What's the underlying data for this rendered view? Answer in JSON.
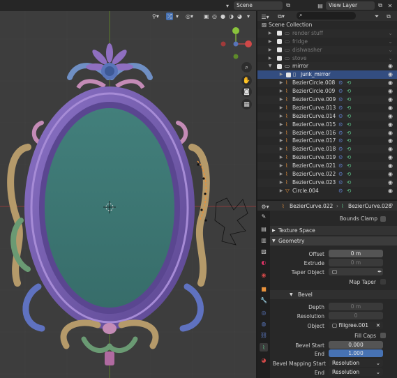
{
  "top_bar": {
    "scene_label": "Scene",
    "view_layer_label": "View Layer"
  },
  "outliner": {
    "search_placeholder": "",
    "rows": [
      {
        "name": "Scene Collection",
        "type": "scene",
        "dim": false
      },
      {
        "name": "render stuff",
        "type": "collection",
        "dim": true
      },
      {
        "name": "fridge",
        "type": "collection",
        "dim": true
      },
      {
        "name": "dishwasher",
        "type": "collection",
        "dim": true
      },
      {
        "name": "stove",
        "type": "collection",
        "dim": true
      },
      {
        "name": "mirror",
        "type": "collection",
        "dim": false
      },
      {
        "name": "junk_mirror",
        "type": "object",
        "dim": false,
        "selected": true
      },
      {
        "name": "BezierCircle.008",
        "type": "curve",
        "dim": false
      },
      {
        "name": "BezierCircle.009",
        "type": "curve",
        "dim": false
      },
      {
        "name": "BezierCurve.009",
        "type": "curve",
        "dim": false
      },
      {
        "name": "BezierCurve.013",
        "type": "curve",
        "dim": false
      },
      {
        "name": "BezierCurve.014",
        "type": "curve",
        "dim": false
      },
      {
        "name": "BezierCurve.015",
        "type": "curve",
        "dim": false
      },
      {
        "name": "BezierCurve.016",
        "type": "curve",
        "dim": false
      },
      {
        "name": "BezierCurve.017",
        "type": "curve",
        "dim": false
      },
      {
        "name": "BezierCurve.018",
        "type": "curve",
        "dim": false
      },
      {
        "name": "BezierCurve.019",
        "type": "curve",
        "dim": false
      },
      {
        "name": "BezierCurve.021",
        "type": "curve",
        "dim": false
      },
      {
        "name": "BezierCurve.022",
        "type": "curve",
        "dim": false,
        "active": true
      },
      {
        "name": "BezierCurve.023",
        "type": "curve",
        "dim": false
      },
      {
        "name": "Circle.004",
        "type": "mesh",
        "dim": false
      }
    ]
  },
  "properties": {
    "object_name": "BezierCurve.022",
    "data_name": "BezierCurve.028",
    "bounds_clamp_label": "Bounds Clamp",
    "texture_space_label": "Texture Space",
    "geometry_label": "Geometry",
    "offset_label": "Offset",
    "offset_value": "0 m",
    "extrude_label": "Extrude",
    "extrude_value": "0 m",
    "taper_object_label": "Taper Object",
    "map_taper_label": "Map Taper",
    "bevel_label": "Bevel",
    "depth_label": "Depth",
    "depth_value": "0 m",
    "resolution_label": "Resolution",
    "resolution_value": "0",
    "object_label": "Object",
    "object_value": "filigree.001",
    "fill_caps_label": "Fill Caps",
    "bevel_start_label": "Bevel Start",
    "bevel_start_value": "0.000",
    "end_label": "End",
    "end_value": "1.000",
    "bevel_mapping_start_label": "Bevel Mapping Start",
    "bevel_mapping_start_value": "Resolution",
    "mapping_end_label": "End",
    "mapping_end_value": "Resolution"
  },
  "colors": {
    "accent": "#4772b3",
    "selected_row": "#334d80",
    "frame_purple": "#7a5fb0",
    "mirror_glass": "#3d7a76",
    "curve_orange": "#e8923c",
    "constraint_green": "#5fc48a"
  }
}
